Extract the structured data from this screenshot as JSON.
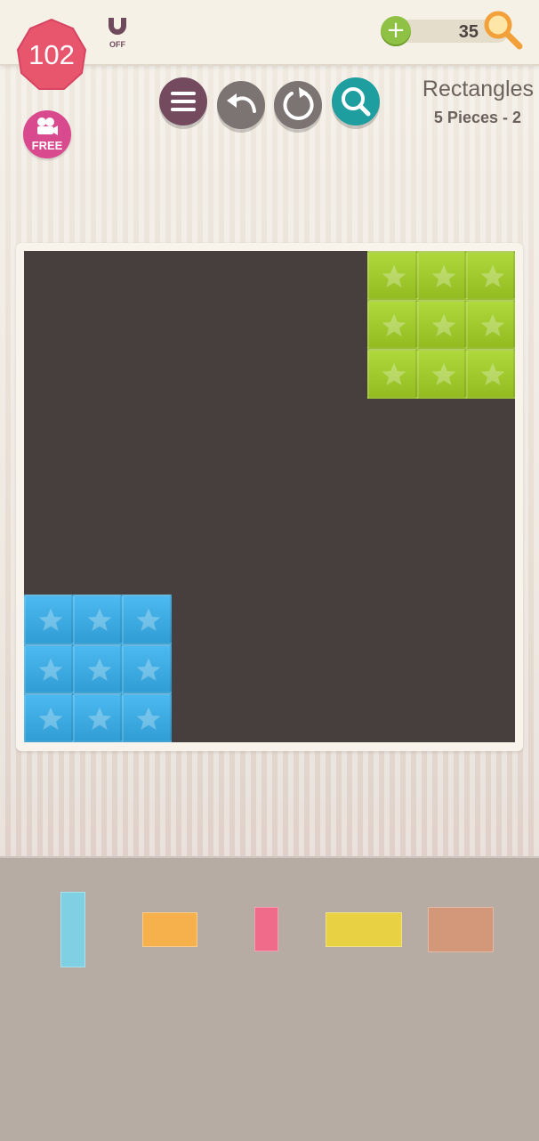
{
  "header": {
    "level": "102",
    "magnet_status": "OFF",
    "coins": "35",
    "plus_symbol": "+"
  },
  "free_video": {
    "label": "FREE"
  },
  "toolbar": {
    "buttons": [
      "menu",
      "undo",
      "restart",
      "hint"
    ]
  },
  "puzzle": {
    "title": "Rectangles",
    "subtitle": "5 Pieces - 2"
  },
  "board": {
    "grid_size": 10,
    "background_color": "#473f3d",
    "placed_pieces": [
      {
        "name": "green-piece",
        "color": "#9cc62a",
        "col": 7,
        "row": 0,
        "cols": 3,
        "rows": 3
      },
      {
        "name": "blue-piece",
        "color": "#3aa7de",
        "col": 0,
        "row": 7,
        "cols": 3,
        "rows": 3
      }
    ]
  },
  "tray": {
    "pieces": [
      {
        "name": "tray-piece-lightblue",
        "color": "#7fd0e3"
      },
      {
        "name": "tray-piece-orange",
        "color": "#f7b14c"
      },
      {
        "name": "tray-piece-pink",
        "color": "#f06a8a"
      },
      {
        "name": "tray-piece-yellow",
        "color": "#e8d244"
      },
      {
        "name": "tray-piece-tan",
        "color": "#d3977a"
      }
    ]
  },
  "colors": {
    "level_badge": "#e8566e",
    "menu_button": "#744a5f",
    "gray_button": "#7b7472",
    "hint_button": "#1f9ea0",
    "free_badge": "#d9498e",
    "coin_plus": "#8fc244"
  }
}
